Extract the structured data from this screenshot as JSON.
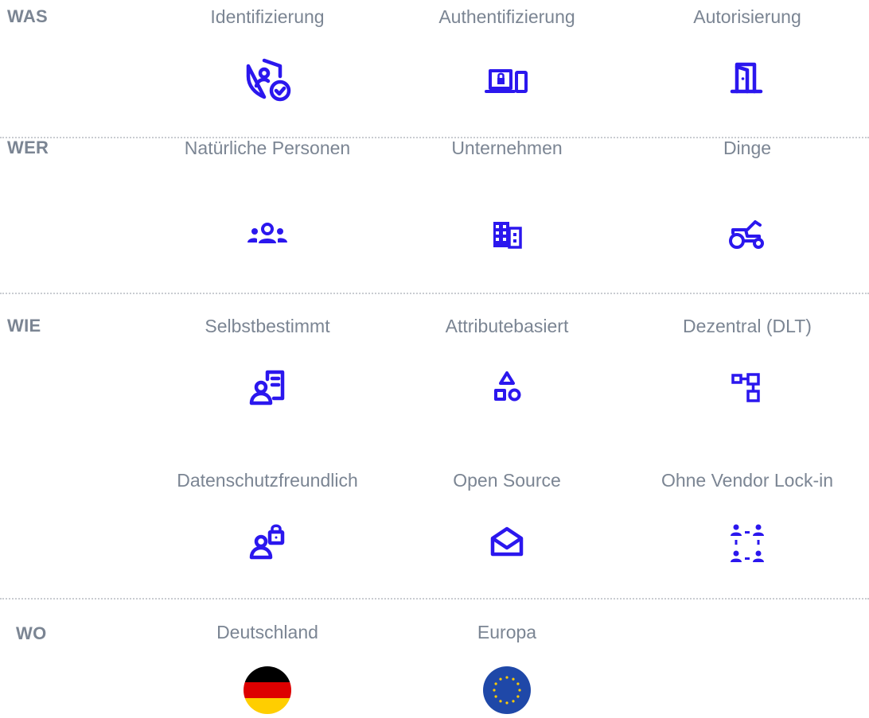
{
  "accent_color": "#2b17ee",
  "sections": {
    "was": {
      "label": "WAS",
      "items": [
        {
          "label": "Identifizierung",
          "icon": "shield-user-check-icon"
        },
        {
          "label": "Authentifizierung",
          "icon": "devices-lock-icon"
        },
        {
          "label": "Autorisierung",
          "icon": "door-icon"
        }
      ]
    },
    "wer": {
      "label": "WER",
      "items": [
        {
          "label": "Natürliche Personen",
          "icon": "people-group-icon"
        },
        {
          "label": "Unternehmen",
          "icon": "building-icon"
        },
        {
          "label": "Dinge",
          "icon": "tractor-icon"
        }
      ]
    },
    "wie": {
      "label": "WIE",
      "items": [
        {
          "label": "Selbstbestimmt",
          "icon": "person-device-icon"
        },
        {
          "label": "Attributebasiert",
          "icon": "shapes-icon"
        },
        {
          "label": "Dezentral (DLT)",
          "icon": "network-nodes-icon"
        },
        {
          "label": "Datenschutzfreundlich",
          "icon": "person-lock-icon"
        },
        {
          "label": "Open Source",
          "icon": "open-envelope-icon"
        },
        {
          "label": "Ohne Vendor Lock-in",
          "icon": "people-swap-icon"
        }
      ]
    },
    "wo": {
      "label": "WO",
      "items": [
        {
          "label": "Deutschland",
          "icon": "germany-flag-icon"
        },
        {
          "label": "Europa",
          "icon": "eu-flag-icon"
        }
      ]
    }
  }
}
